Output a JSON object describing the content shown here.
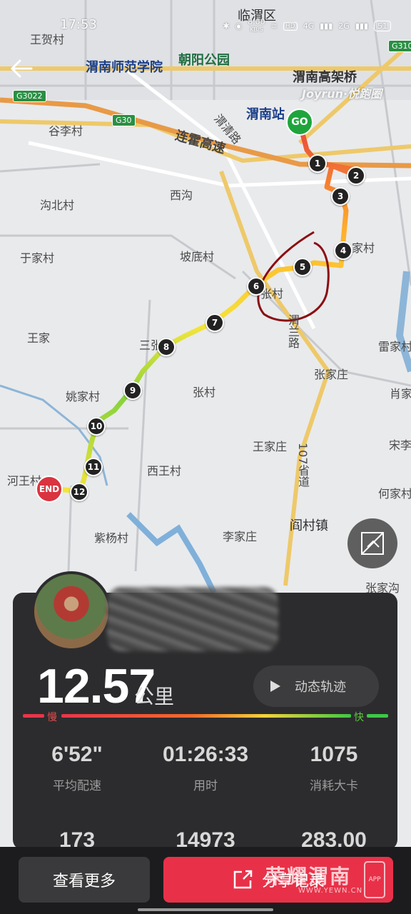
{
  "status_bar": {
    "time": "17:53",
    "speed": "8.00",
    "speed_unit": "KB/S",
    "network1": "4G",
    "network2": "2G",
    "battery": "51"
  },
  "map": {
    "brand": "Joyrun·悦跑圈",
    "places": [
      "临渭区",
      "王贺村",
      "渭南师范学院",
      "朝阳公园",
      "渭南高架桥",
      "渭南站",
      "谷李村",
      "连霍高速",
      "渭清路",
      "西沟",
      "沟北村",
      "于家村",
      "坡底村",
      "家村",
      "张村",
      "王家",
      "三张镇",
      "张村",
      "雷家村",
      "张家庄",
      "姚家村",
      "肖家",
      "宋李",
      "王家庄",
      "107省道",
      "西王村",
      "河王村",
      "何家村",
      "阎村镇",
      "紫杨村",
      "李家庄",
      "张家沟",
      "渭兰路"
    ],
    "highways": [
      "G3022",
      "G30",
      "G310"
    ],
    "start_label": "GO",
    "end_label": "END",
    "km_markers": [
      "1",
      "2",
      "3",
      "4",
      "5",
      "6",
      "7",
      "8",
      "9",
      "10",
      "11",
      "12"
    ]
  },
  "summary": {
    "distance": "12.57",
    "distance_unit": "公里",
    "replay_label": "动态轨迹",
    "pace_slow": "慢",
    "pace_fast": "快",
    "stats": [
      {
        "value": "6'52\"",
        "label": "平均配速"
      },
      {
        "value": "01:26:33",
        "label": "用时"
      },
      {
        "value": "1075",
        "label": "消耗大卡"
      },
      {
        "value": "173",
        "label": ""
      },
      {
        "value": "14973",
        "label": ""
      },
      {
        "value": "283.00",
        "label": ""
      }
    ]
  },
  "actions": {
    "more_label": "查看更多",
    "share_label": "分享记录"
  },
  "watermark": {
    "text": "荣耀渭南",
    "sub": "WWW.YEWN.CN",
    "badge": "APP"
  }
}
